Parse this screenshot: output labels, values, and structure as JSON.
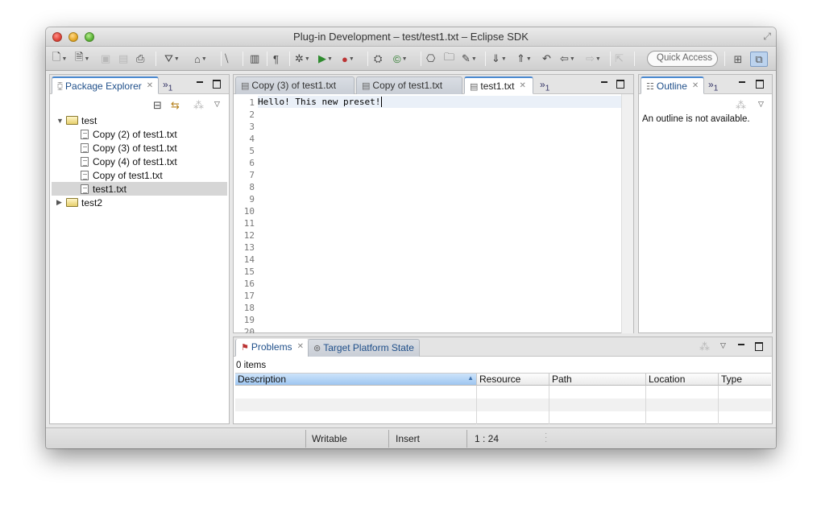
{
  "window": {
    "title": "Plug-in Development – test/test1.txt – Eclipse SDK"
  },
  "toolbar": {
    "quick_access_placeholder": "Quick Access"
  },
  "package_explorer": {
    "tab_label": "Package Explorer",
    "overflow_count": "1",
    "tree": [
      {
        "label": "test",
        "type": "project",
        "expanded": true
      },
      {
        "label": "Copy (2) of test1.txt",
        "type": "file"
      },
      {
        "label": "Copy (3) of test1.txt",
        "type": "file"
      },
      {
        "label": "Copy (4) of test1.txt",
        "type": "file"
      },
      {
        "label": "Copy of test1.txt",
        "type": "file"
      },
      {
        "label": "test1.txt",
        "type": "file",
        "selected": true
      },
      {
        "label": "test2",
        "type": "project",
        "expanded": false
      }
    ]
  },
  "editor": {
    "tabs": [
      {
        "label": "Copy (3) of test1.txt"
      },
      {
        "label": "Copy of test1.txt"
      },
      {
        "label": "test1.txt",
        "active": true
      }
    ],
    "overflow_count": "1",
    "line_numbers": [
      "1",
      "2",
      "3",
      "4",
      "5",
      "6",
      "7",
      "8",
      "9",
      "10",
      "11",
      "12",
      "13",
      "14",
      "15",
      "16",
      "17",
      "18",
      "19",
      "20"
    ],
    "content_line1": "Hello! This new preset!"
  },
  "outline": {
    "tab_label": "Outline",
    "overflow_count": "1",
    "message": "An outline is not available."
  },
  "problems": {
    "tabs": [
      {
        "label": "Problems",
        "active": true
      },
      {
        "label": "Target Platform State"
      }
    ],
    "item_count": "0 items",
    "columns": [
      "Description",
      "Resource",
      "Path",
      "Location",
      "Type"
    ]
  },
  "statusbar": {
    "writable": "Writable",
    "insert_mode": "Insert",
    "cursor_position": "1 : 24"
  },
  "colors": {
    "accent": "#4b89d0",
    "selection": "#d6d6d6"
  }
}
